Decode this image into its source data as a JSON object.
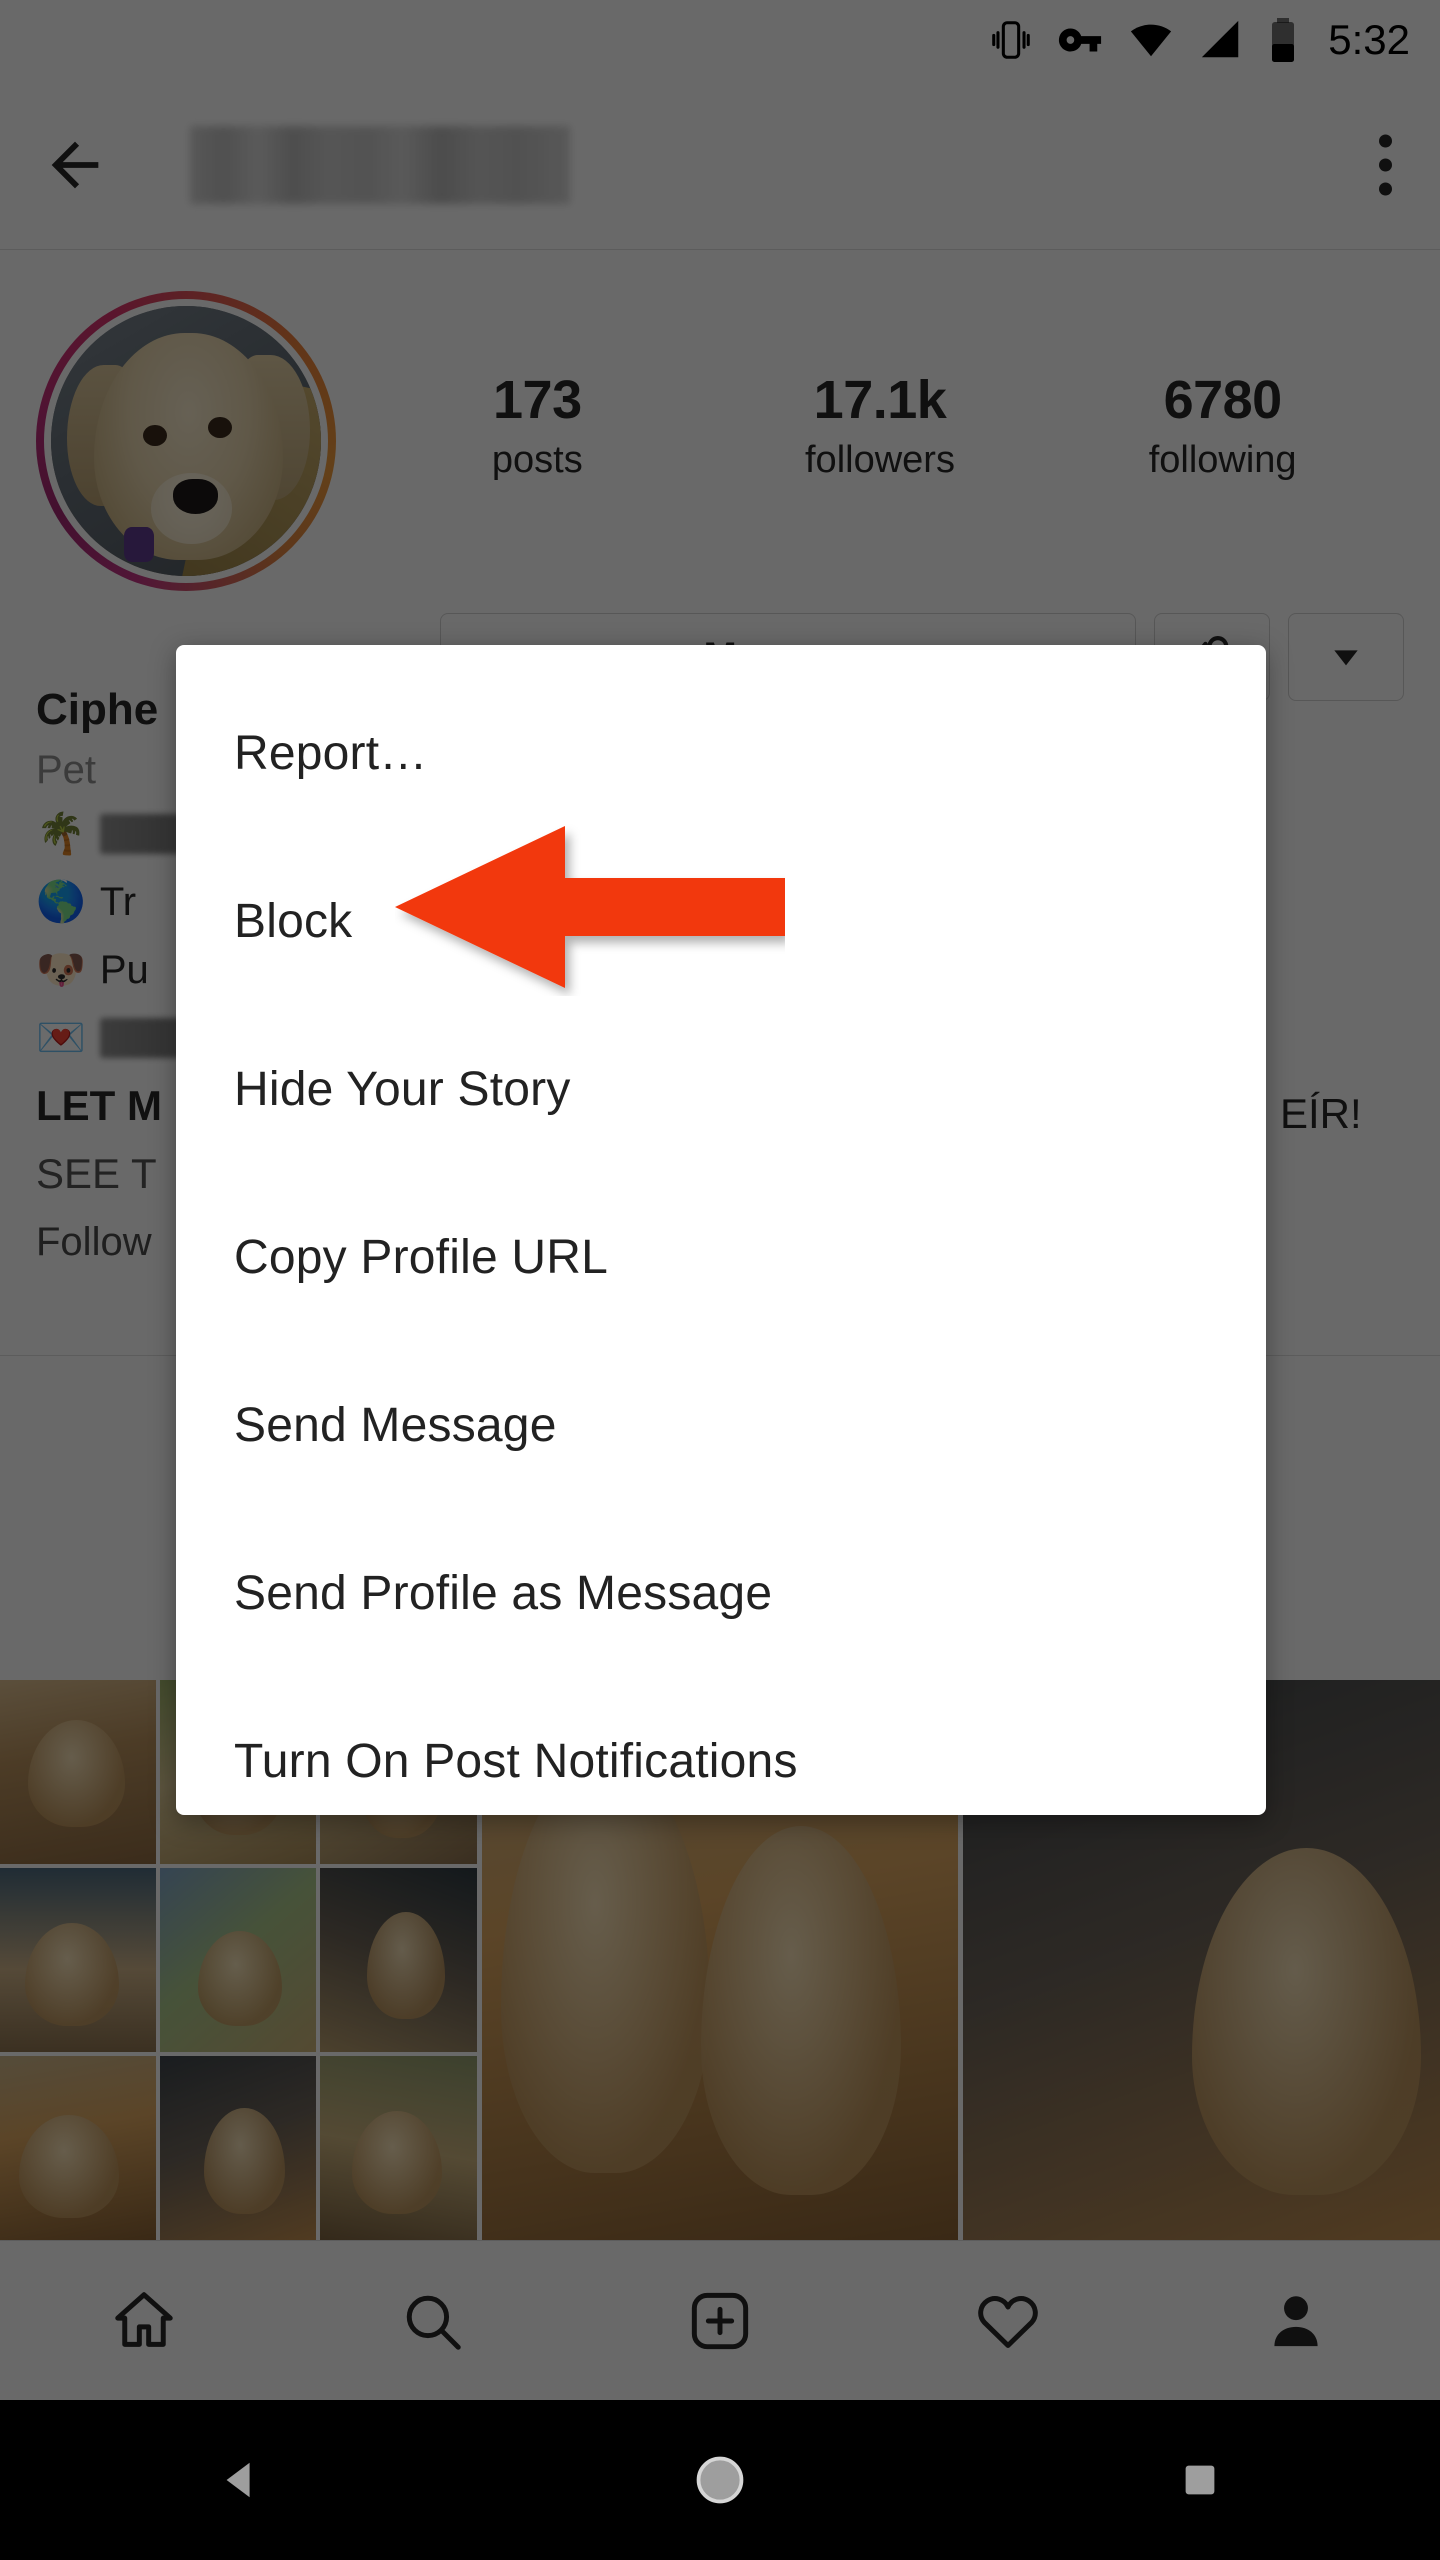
{
  "status_bar": {
    "time": "5:32",
    "icons": [
      "vibrate-icon",
      "vpn-key-icon",
      "wifi-icon",
      "cellular-signal-icon",
      "battery-icon"
    ]
  },
  "toolbar": {
    "back_icon": "back-arrow-icon",
    "title": "",
    "title_redacted": true,
    "overflow_icon": "overflow-menu-icon"
  },
  "profile": {
    "avatar_alt": "golden retriever puppy profile photo",
    "has_story_ring": true,
    "stats": [
      {
        "value": "173",
        "label": "posts"
      },
      {
        "value": "17.1k",
        "label": "followers"
      },
      {
        "value": "6780",
        "label": "following"
      }
    ],
    "actions": {
      "message_label": "Message",
      "following_icon": "person-check-icon",
      "dropdown_icon": "caret-down-icon"
    },
    "bio": {
      "name": "Ciphe",
      "category": "Pet",
      "lines": [
        {
          "emoji": "🌴",
          "text": "",
          "redacted": true,
          "redact_width": 150
        },
        {
          "emoji": "🌎",
          "text": "Tr",
          "redacted": false,
          "redact_width": 0
        },
        {
          "emoji": "🐶",
          "text": "Pu",
          "redacted": false,
          "redact_width": 0
        },
        {
          "emoji": "💌",
          "text": "",
          "redacted": true,
          "redact_width": 150
        }
      ],
      "headline_left": "LET M",
      "headline_right": "EÍR!",
      "subline": "SEE T",
      "link_text": "Follow"
    }
  },
  "menu": {
    "items": [
      "Report…",
      "Block",
      "Hide Your Story",
      "Copy Profile URL",
      "Send Message",
      "Send Profile as Message",
      "Turn On Post Notifications"
    ],
    "highlighted_index": 1
  },
  "annotation": {
    "arrow_color": "#F2380F",
    "arrow_direction": "left",
    "points_to": "Block"
  },
  "bottom_nav": {
    "items": [
      {
        "icon": "home-icon",
        "active": false
      },
      {
        "icon": "search-icon",
        "active": false
      },
      {
        "icon": "add-post-icon",
        "active": false
      },
      {
        "icon": "heart-icon",
        "active": false
      },
      {
        "icon": "profile-icon",
        "active": true
      }
    ]
  },
  "android_nav": {
    "items": [
      "back-triangle-icon",
      "home-circle-icon",
      "recents-square-icon"
    ]
  },
  "grid": {
    "cells": [
      {
        "name": "collage-of-puppy-photos",
        "kind": "collage"
      },
      {
        "name": "two-dogs-photo",
        "kind": "single"
      },
      {
        "name": "dog-in-car-photo",
        "kind": "single"
      }
    ]
  },
  "colors": {
    "accent_red": "#F2380F",
    "app_bg": "#fafafa",
    "text_primary": "#262626",
    "text_secondary": "#8e8e8e",
    "scrim": "rgba(0,0,0,0.58)"
  }
}
